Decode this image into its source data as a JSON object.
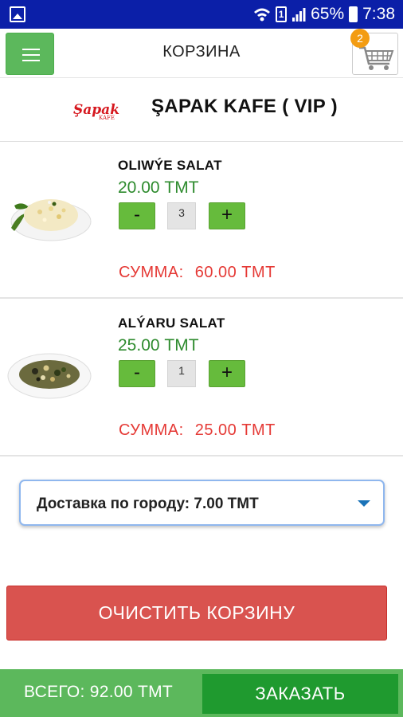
{
  "status_bar": {
    "battery": "65%",
    "time": "7:38",
    "sim_label": "1"
  },
  "header": {
    "title": "КОРЗИНА",
    "cart_count": "2"
  },
  "restaurant": {
    "logo_text": "Şapak",
    "logo_sub": "KAFE",
    "name": "ŞAPAK KAFE ( VIP )"
  },
  "items": [
    {
      "name": "OLIWÝE SALAT",
      "price": "20.00 ТМТ",
      "qty": "3",
      "minus": "-",
      "plus": "+",
      "sum_label": "СУММА:",
      "sum_value": "60.00 ТМТ"
    },
    {
      "name": "ALÝARU SALAT",
      "price": "25.00 ТМТ",
      "qty": "1",
      "minus": "-",
      "plus": "+",
      "sum_label": "СУММА:",
      "sum_value": "25.00 ТМТ"
    }
  ],
  "delivery": {
    "selected": "Доставка по городу: 7.00 ТМТ"
  },
  "clear_cart_label": "ОЧИСТИТЬ КОРЗИНУ",
  "footer": {
    "total": "ВСЕГО: 92.00 ТМТ",
    "order_label": "ЗАКАЗАТЬ"
  },
  "colors": {
    "status_bar": "#0b1fa8",
    "green_button": "#5cb85c",
    "price_green": "#2e8b2e",
    "sum_red": "#e53935",
    "clear_red": "#d9534f",
    "order_green": "#1f9a2f",
    "badge_orange": "#f39c12"
  }
}
